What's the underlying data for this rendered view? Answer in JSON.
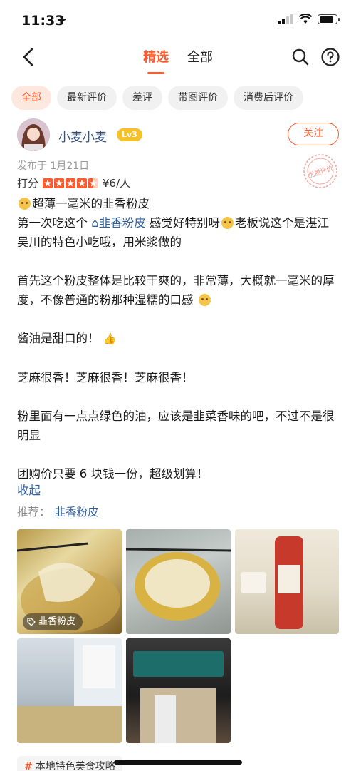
{
  "status_bar": {
    "time": "11:33",
    "battery_level": 0.85,
    "signal_bars": 2
  },
  "nav": {
    "tabs": [
      {
        "label": "精选",
        "active": true
      },
      {
        "label": "全部",
        "active": false
      }
    ]
  },
  "filters": [
    {
      "label": "全部",
      "active": true
    },
    {
      "label": "最新评价",
      "active": false
    },
    {
      "label": "差评",
      "active": false
    },
    {
      "label": "带图评价",
      "active": false
    },
    {
      "label": "消费后评价",
      "active": false
    }
  ],
  "review": {
    "user": {
      "name": "小麦小麦",
      "level": "Lv3",
      "follow_label": "关注"
    },
    "stamp_text": "优质评价",
    "posted": "发布于 1月21日",
    "rating": {
      "label": "打分",
      "stars": 4.5,
      "price": "¥6/人"
    },
    "title": "超薄一毫米的韭香粉皮",
    "paragraphs": {
      "p1_a": "第一次吃这个",
      "p1_link": "韭香粉皮",
      "p1_b": "感觉好特别呀",
      "p1_c": "老板说这个是湛江吴川的特色小吃哦，用米浆做的",
      "p2": "首先这个粉皮整体是比较干爽的，非常薄，大概就一毫米的厚度，不像普通的粉那种湿糯的口感",
      "p3": "酱油是甜口的！",
      "p4": "芝麻很香！芝麻很香！芝麻很香！",
      "p5": "粉里面有一点点绿色的油，应该是韭菜香味的吧，不过不是很明显",
      "p6": "团购价只要 6 块钱一份，超级划算！"
    },
    "collapse_label": "收起",
    "recommend_label": "推荐：",
    "recommend_dish": "韭香粉皮",
    "photo_tag": "韭香粉皮",
    "photo_count": 5,
    "topic": "本地特色美食攻略"
  },
  "colors": {
    "accent": "#ff5a2b",
    "link": "#2f5f9e",
    "level_badge": "#f5c12a"
  },
  "icons": [
    "back-arrow-icon",
    "search-icon",
    "help-icon",
    "tag-icon",
    "hash-icon"
  ]
}
